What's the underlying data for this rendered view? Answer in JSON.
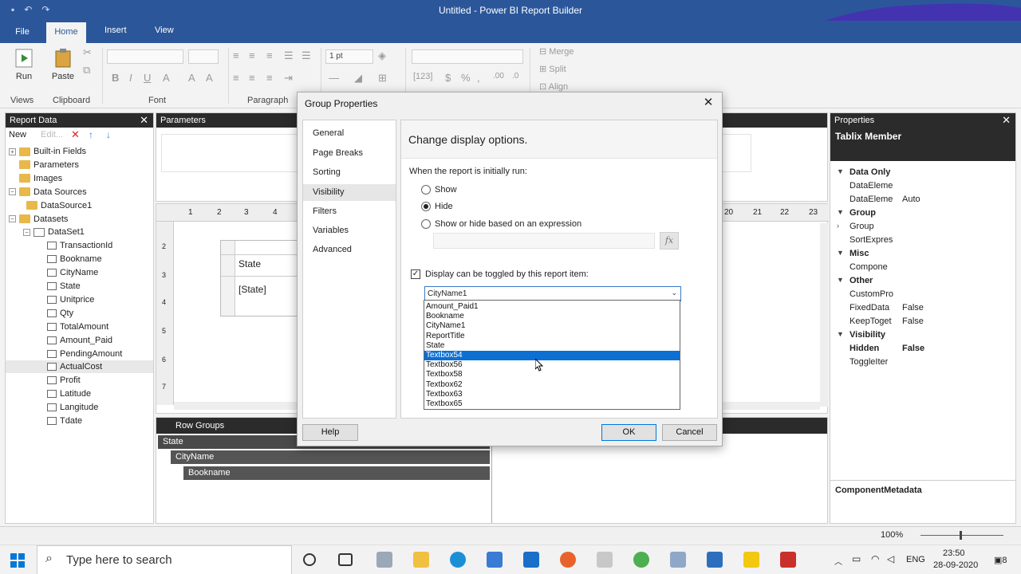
{
  "window": {
    "title": "Untitled - Power BI Report Builder"
  },
  "ribbon": {
    "tabs": [
      "File",
      "Home",
      "Insert",
      "View"
    ],
    "groups": [
      "Views",
      "Clipboard",
      "Font",
      "Paragraph"
    ],
    "buttons": {
      "run": "Run",
      "paste": "Paste",
      "merge": "Merge",
      "split": "Split",
      "align": "Align"
    },
    "border_width": "1 pt"
  },
  "report_data": {
    "title": "Report Data",
    "new_label": "New",
    "edit_label": "Edit...",
    "items": [
      {
        "label": "Built-in Fields",
        "kind": "folder",
        "expander": "+"
      },
      {
        "label": "Parameters",
        "kind": "folder",
        "expander": ""
      },
      {
        "label": "Images",
        "kind": "folder",
        "expander": ""
      },
      {
        "label": "Data Sources",
        "kind": "folder",
        "expander": "−"
      },
      {
        "label": "DataSource1",
        "kind": "datasource",
        "expander": ""
      },
      {
        "label": "Datasets",
        "kind": "folder",
        "expander": "−"
      },
      {
        "label": "DataSet1",
        "kind": "dataset",
        "expander": "−"
      },
      {
        "label": "TransactionId",
        "kind": "field",
        "expander": ""
      },
      {
        "label": "Bookname",
        "kind": "field",
        "expander": ""
      },
      {
        "label": "CityName",
        "kind": "field",
        "expander": ""
      },
      {
        "label": "State",
        "kind": "field",
        "expander": ""
      },
      {
        "label": "Unitprice",
        "kind": "field",
        "expander": ""
      },
      {
        "label": "Qty",
        "kind": "field",
        "expander": ""
      },
      {
        "label": "TotalAmount",
        "kind": "field",
        "expander": ""
      },
      {
        "label": "Amount_Paid",
        "kind": "field",
        "expander": ""
      },
      {
        "label": "PendingAmount",
        "kind": "field",
        "expander": ""
      },
      {
        "label": "ActualCost",
        "kind": "field",
        "expander": "",
        "selected": true
      },
      {
        "label": "Profit",
        "kind": "field",
        "expander": ""
      },
      {
        "label": "Latitude",
        "kind": "field",
        "expander": ""
      },
      {
        "label": "Langitude",
        "kind": "field",
        "expander": ""
      },
      {
        "label": "Tdate",
        "kind": "field",
        "expander": ""
      }
    ]
  },
  "parameters": {
    "title": "Parameters"
  },
  "design": {
    "ruler_left": [
      "1",
      "2",
      "3",
      "4"
    ],
    "ruler_right": [
      "20",
      "21",
      "22",
      "23"
    ],
    "vruler": [
      "2",
      "3",
      "4",
      "5",
      "6",
      "7"
    ],
    "header_cell": "State",
    "detail_cell": "[State]"
  },
  "row_groups": {
    "title": "Row Groups",
    "items": [
      "State",
      "CityName",
      "Bookname"
    ]
  },
  "properties": {
    "title": "Properties",
    "object": "Tablix Member",
    "rows": [
      {
        "k": "Data Only",
        "v": "",
        "cat": true
      },
      {
        "k": "DataEleme",
        "v": "",
        "cat": false
      },
      {
        "k": "DataEleme",
        "v": "Auto",
        "cat": false
      },
      {
        "k": "Group",
        "v": "",
        "cat": true
      },
      {
        "k": "Group",
        "v": "",
        "cat": false,
        "sub": true
      },
      {
        "k": "SortExpres",
        "v": "",
        "cat": false
      },
      {
        "k": "Misc",
        "v": "",
        "cat": true
      },
      {
        "k": "Compone",
        "v": "",
        "cat": false
      },
      {
        "k": "Other",
        "v": "",
        "cat": true
      },
      {
        "k": "CustomPro",
        "v": "",
        "cat": false
      },
      {
        "k": "FixedData",
        "v": "False",
        "cat": false
      },
      {
        "k": "KeepToget",
        "v": "False",
        "cat": false
      },
      {
        "k": "Visibility",
        "v": "",
        "cat": true
      },
      {
        "k": "Hidden",
        "v": "False",
        "cat": false,
        "bold": true
      },
      {
        "k": "ToggleIter",
        "v": "",
        "cat": false
      }
    ],
    "description": "ComponentMetadata"
  },
  "status": {
    "zoom": "100%"
  },
  "taskbar": {
    "search_placeholder": "Type here to search",
    "language": "ENG",
    "time": "23:50",
    "date": "28-09-2020",
    "notifications": "8"
  },
  "dialog": {
    "title": "Group Properties",
    "nav": [
      "General",
      "Page Breaks",
      "Sorting",
      "Visibility",
      "Filters",
      "Variables",
      "Advanced"
    ],
    "selected_nav": "Visibility",
    "heading": "Change display options.",
    "initial_run_label": "When the report is initially run:",
    "options": [
      "Show",
      "Hide",
      "Show or hide based on an expression"
    ],
    "selected_option": "Hide",
    "fx_label": "fx",
    "toggle_label": "Display can be toggled by this report item:",
    "toggle_checked": true,
    "toggle_value": "CityName1",
    "dropdown_items": [
      "Amount_Paid1",
      "Bookname",
      "CityName1",
      "ReportTitle",
      "State",
      "Textbox54",
      "Textbox56",
      "Textbox58",
      "Textbox62",
      "Textbox63",
      "Textbox65"
    ],
    "highlighted_item": "Textbox54",
    "buttons": {
      "help": "Help",
      "ok": "OK",
      "cancel": "Cancel"
    }
  }
}
